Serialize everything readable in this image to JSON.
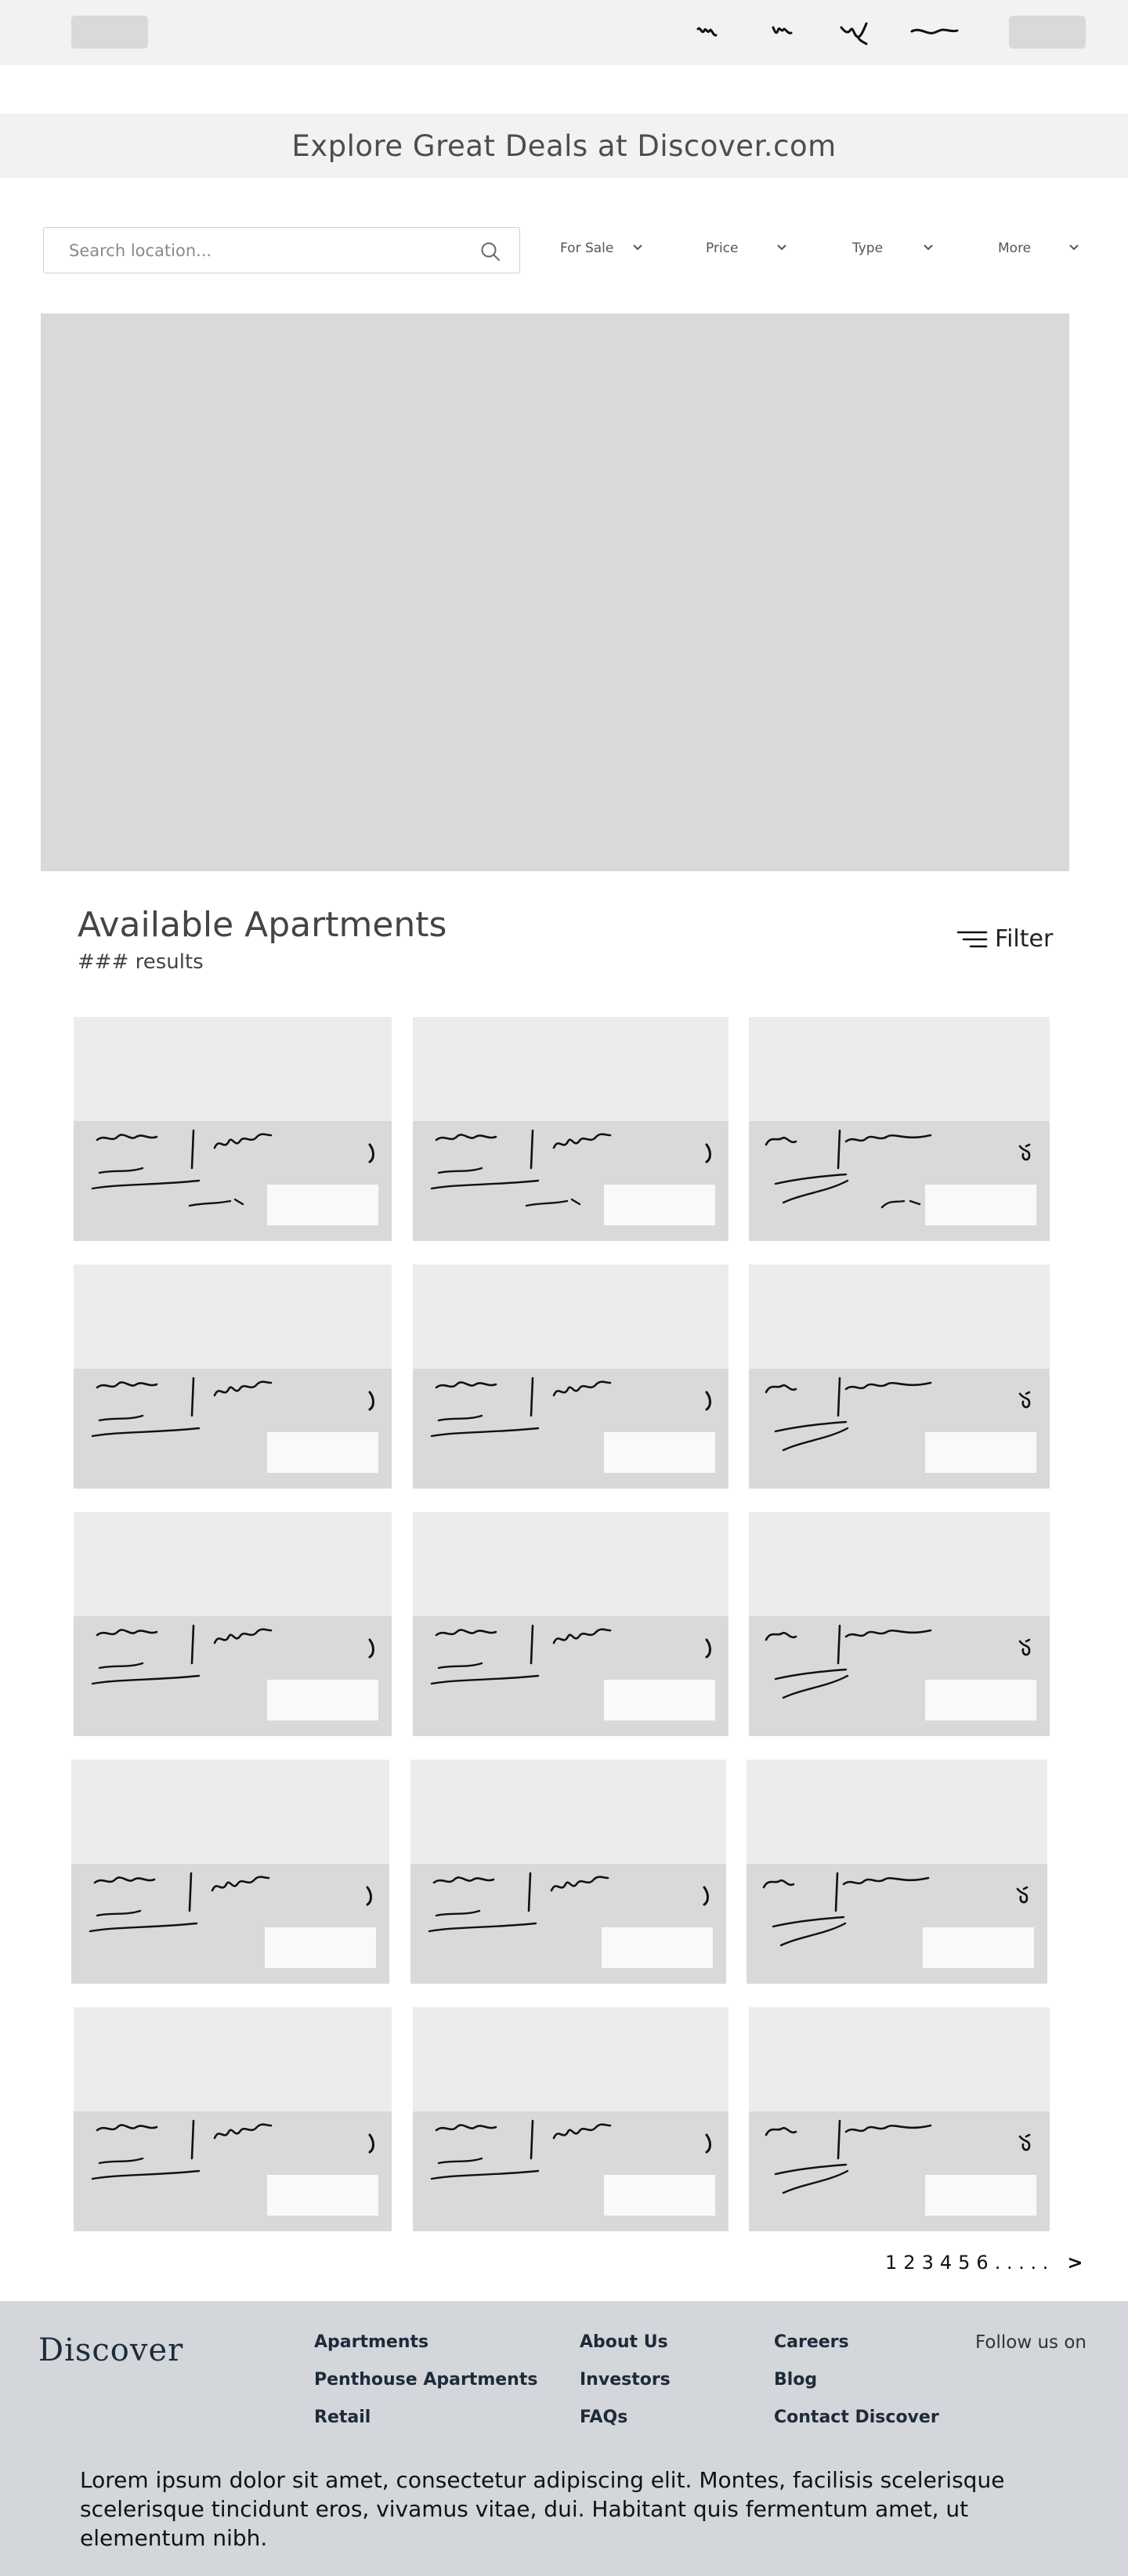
{
  "header": {
    "logo": "logo-placeholder",
    "nav_items": [
      "nav-scribble-1",
      "nav-scribble-2",
      "nav-scribble-3",
      "nav-scribble-4"
    ],
    "login": "login-placeholder"
  },
  "banner": {
    "title": "Explore Great Deals at Discover.com"
  },
  "search": {
    "placeholder": "Search location...",
    "icon": "search-icon"
  },
  "filters": [
    {
      "label": "For Sale",
      "icon": "chevron-down-icon"
    },
    {
      "label": "Price",
      "icon": "chevron-down-icon"
    },
    {
      "label": "Type",
      "icon": "chevron-down-icon"
    },
    {
      "label": "More",
      "icon": "chevron-down-icon"
    }
  ],
  "listing": {
    "title": "Available Apartments",
    "results": "### results",
    "filter_label": "Filter",
    "filter_icon": "filter-lines-icon",
    "card_count": 15
  },
  "pagination": {
    "pages": [
      "1",
      "2",
      "3",
      "4",
      "5",
      "6"
    ],
    "ellipsis": ". . . . .",
    "next": ">"
  },
  "footer": {
    "brand": "Discover",
    "col1": [
      "Apartments",
      "Penthouse Apartments",
      "Retail"
    ],
    "col2": [
      "About Us",
      "Investors",
      "FAQs"
    ],
    "col3": [
      "Careers",
      "Blog",
      "Contact Discover"
    ],
    "follow": "Follow us on",
    "text": "Lorem ipsum dolor sit amet, consectetur adipiscing elit. Montes, facilisis scelerisque scelerisque tincidunt eros, vivamus vitae, dui. Habitant quis fermentum amet, ut elementum nibh."
  },
  "colors": {
    "header_bg": "#f2f2f2",
    "placeholder": "#d9d9d9",
    "card_image": "#ececec",
    "footer_bg": "#d3d6da",
    "footer_link": "#1e2a3a"
  }
}
